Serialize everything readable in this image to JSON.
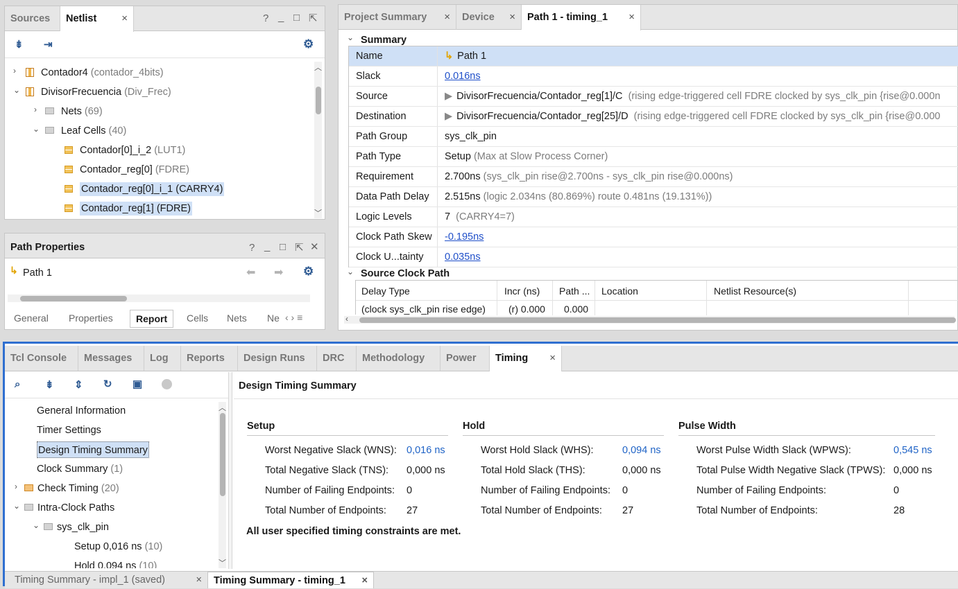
{
  "sources_panel": {
    "tabs": [
      {
        "label": "Sources"
      },
      {
        "label": "Netlist"
      }
    ],
    "controls": {
      "help": "?",
      "minimize": "_",
      "maximize": "□",
      "float": "⇱"
    },
    "tree": [
      {
        "label": "Contador4",
        "detail": "(contador_4bits)"
      },
      {
        "label": "DivisorFrecuencia",
        "detail": "(Div_Frec)"
      },
      {
        "label": "Nets",
        "detail": "(69)"
      },
      {
        "label": "Leaf Cells",
        "detail": "(40)"
      },
      {
        "label": "Contador[0]_i_2",
        "detail": "(LUT1)"
      },
      {
        "label": "Contador_reg[0]",
        "detail": "(FDRE)"
      },
      {
        "label": "Contador_reg[0]_i_1 (CARRY4)",
        "detail": ""
      },
      {
        "label": "Contador_reg[1] (FDRE)",
        "detail": ""
      }
    ]
  },
  "path_properties": {
    "title": "Path Properties",
    "item": "Path 1",
    "tabs": [
      "General",
      "Properties",
      "Report",
      "Cells",
      "Nets",
      "Ne"
    ]
  },
  "top_tabs": [
    {
      "label": "Project Summary"
    },
    {
      "label": "Device"
    },
    {
      "label": "Path 1 - timing_1"
    }
  ],
  "summary": {
    "section_title": "Summary",
    "rows": [
      {
        "key": "Name",
        "value": "Path 1",
        "extra": ""
      },
      {
        "key": "Slack",
        "value": "0.016ns",
        "extra": ""
      },
      {
        "key": "Source",
        "value": "DivisorFrecuencia/Contador_reg[1]/C",
        "extra": "(rising edge-triggered cell FDRE clocked by sys_clk_pin  {rise@0.000n"
      },
      {
        "key": "Destination",
        "value": "DivisorFrecuencia/Contador_reg[25]/D",
        "extra": "(rising edge-triggered cell FDRE clocked by sys_clk_pin  {rise@0.000"
      },
      {
        "key": "Path Group",
        "value": "sys_clk_pin",
        "extra": ""
      },
      {
        "key": "Path Type",
        "value": "Setup",
        "extra": "(Max at Slow Process Corner)"
      },
      {
        "key": "Requirement",
        "value": "2.700ns",
        "extra": "(sys_clk_pin rise@2.700ns - sys_clk_pin rise@0.000ns)"
      },
      {
        "key": "Data Path Delay",
        "value": "2.515ns",
        "extra": "(logic 2.034ns (80.869%)  route 0.481ns (19.131%))"
      },
      {
        "key": "Logic Levels",
        "value": "7",
        "extra": "(CARRY4=7)"
      },
      {
        "key": "Clock Path Skew",
        "value": "-0.195ns",
        "extra": ""
      },
      {
        "key": "Clock U...tainty",
        "value": "0.035ns",
        "extra": ""
      }
    ]
  },
  "source_clock_path": {
    "section_title": "Source Clock Path",
    "columns": [
      "Delay Type",
      "Incr (ns)",
      "Path ...",
      "Location",
      "Netlist Resource(s)"
    ],
    "row": [
      "(clock sys_clk_pin rise edge)",
      "(r) 0.000",
      "0.000",
      "",
      ""
    ]
  },
  "bottom_tabs": [
    {
      "label": "Tcl Console"
    },
    {
      "label": "Messages"
    },
    {
      "label": "Log"
    },
    {
      "label": "Reports"
    },
    {
      "label": "Design Runs"
    },
    {
      "label": "DRC"
    },
    {
      "label": "Methodology"
    },
    {
      "label": "Power"
    },
    {
      "label": "Timing"
    }
  ],
  "timing_tree": [
    {
      "label": "General Information",
      "detail": ""
    },
    {
      "label": "Timer Settings",
      "detail": ""
    },
    {
      "label": "Design Timing Summary",
      "detail": ""
    },
    {
      "label": "Clock Summary",
      "detail": "(1)"
    },
    {
      "label": "Check Timing",
      "detail": "(20)"
    },
    {
      "label": "Intra-Clock Paths",
      "detail": ""
    },
    {
      "label": "sys_clk_pin",
      "detail": ""
    },
    {
      "label": "Setup 0,016 ns",
      "detail": "(10)"
    },
    {
      "label": "Hold 0,094 ns",
      "detail": "(10)"
    }
  ],
  "timing_summary": {
    "title": "Design Timing Summary",
    "setup": {
      "header": "Setup",
      "rows": [
        {
          "label": "Worst Negative Slack (WNS):",
          "value": "0,016 ns"
        },
        {
          "label": "Total Negative Slack (TNS):",
          "value": "0,000 ns"
        },
        {
          "label": "Number of Failing Endpoints:",
          "value": "0"
        },
        {
          "label": "Total Number of Endpoints:",
          "value": "27"
        }
      ]
    },
    "hold": {
      "header": "Hold",
      "rows": [
        {
          "label": "Worst Hold Slack (WHS):",
          "value": "0,094 ns"
        },
        {
          "label": "Total Hold Slack (THS):",
          "value": "0,000 ns"
        },
        {
          "label": "Number of Failing Endpoints:",
          "value": "0"
        },
        {
          "label": "Total Number of Endpoints:",
          "value": "27"
        }
      ]
    },
    "pulse": {
      "header": "Pulse Width",
      "rows": [
        {
          "label": "Worst Pulse Width Slack (WPWS):",
          "value": "0,545 ns"
        },
        {
          "label": "Total Pulse Width Negative Slack (TPWS):",
          "value": "0,000 ns"
        },
        {
          "label": "Number of Failing Endpoints:",
          "value": "0"
        },
        {
          "label": "Total Number of Endpoints:",
          "value": "28"
        }
      ]
    },
    "message": "All user specified timing constraints are met."
  },
  "footer_tabs": [
    {
      "label": "Timing Summary - impl_1 (saved)"
    },
    {
      "label": "Timing Summary - timing_1"
    }
  ],
  "colors": {
    "accent": "#2f6fd0",
    "selection": "#cfe0f6",
    "link": "#1f4fc9"
  }
}
